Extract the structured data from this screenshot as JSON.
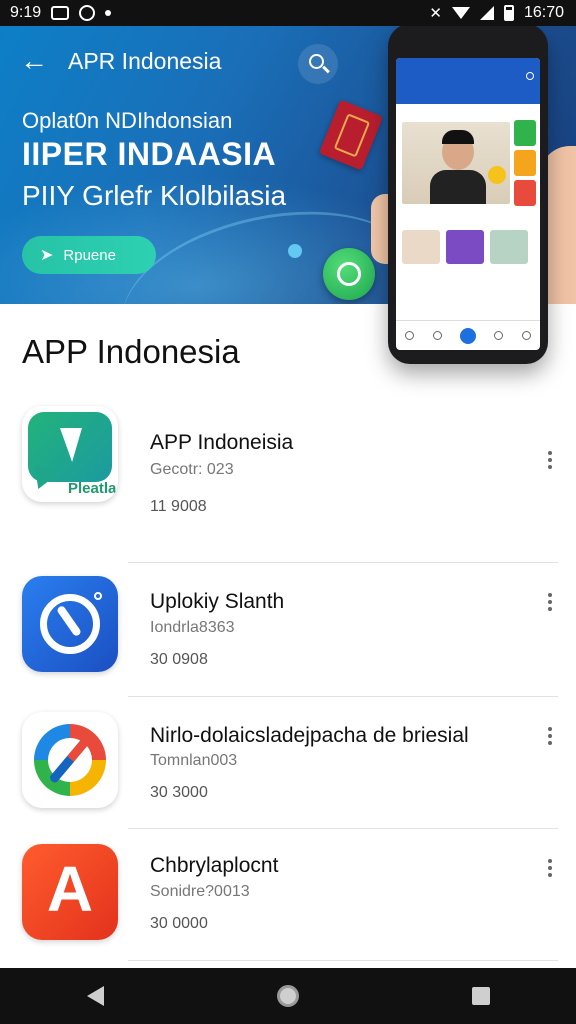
{
  "status_bar": {
    "time": "9:19",
    "clock_right": "16:70"
  },
  "header": {
    "title": "APR Indonesia"
  },
  "banner": {
    "line1": "Oplat0n NDIhdonsian",
    "line2": "IIPER INDAASIA",
    "line3": "PIIY Grlefr Klolbilasia",
    "cta_label": "Rpuene"
  },
  "section": {
    "title": "APP Indonesia"
  },
  "apps": [
    {
      "name": "APP Indoneisia",
      "developer": "Gecotr: 023",
      "size": "11 9008",
      "icon": "chat-bubble-icon",
      "icon_label": "Pleatla"
    },
    {
      "name": "Uplokiy Slanth",
      "developer": "Iondrla8363",
      "size": "30 0908",
      "icon": "compass-icon"
    },
    {
      "name": "Nirlo-dolaicsladejpacha de briesial",
      "developer": "Tomnlan003",
      "size": "30 3000",
      "icon": "color-ring-icon"
    },
    {
      "name": "Chbrylaplocnt",
      "developer": "Sonidre?0013",
      "size": "30 0000",
      "icon": "letter-a-icon",
      "icon_label": "A"
    }
  ],
  "colors": {
    "banner": "#1a6fb8",
    "cta": "#27c3a6",
    "nav": "#111111"
  }
}
